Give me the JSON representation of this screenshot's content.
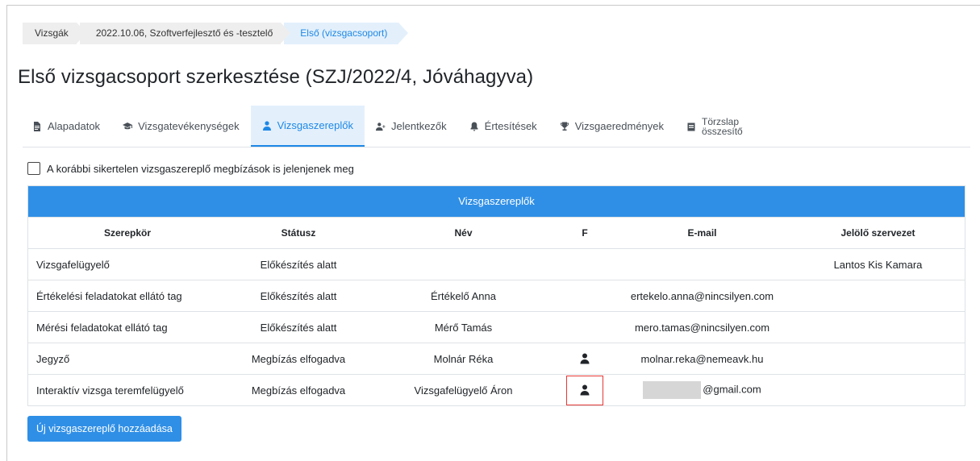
{
  "breadcrumb": [
    {
      "label": "Vizsgák"
    },
    {
      "label": "2022.10.06, Szoftverfejlesztő és -tesztelő"
    },
    {
      "label": "Első (vizsgacsoport)"
    }
  ],
  "page_title": "Első vizsgacsoport szerkesztése (SZJ/2022/4, Jóváhagyva)",
  "tabs": [
    {
      "label": "Alapadatok",
      "icon": "document-icon"
    },
    {
      "label": "Vizsgatevékenységek",
      "icon": "graduation-cap-icon"
    },
    {
      "label": "Vizsgaszereplők",
      "icon": "user-icon"
    },
    {
      "label": "Jelentkezők",
      "icon": "user-plus-icon"
    },
    {
      "label": "Értesítések",
      "icon": "bell-icon"
    },
    {
      "label": "Vizsgaeredmények",
      "icon": "trophy-icon"
    },
    {
      "label_line1": "Törzslap",
      "label_line2": "összesítő",
      "icon": "clipboard-icon"
    }
  ],
  "checkbox": {
    "label": "A korábbi sikertelen vizsgaszereplő megbízások is jelenjenek meg",
    "checked": false
  },
  "table": {
    "title": "Vizsgaszereplők",
    "columns": [
      "Szerepkör",
      "Státusz",
      "Név",
      "F",
      "E-mail",
      "Jelölő szervezet"
    ],
    "rows": [
      {
        "role": "Vizsgafelügyelő",
        "status": "Előkészítés alatt",
        "name": "",
        "f": false,
        "email": "",
        "org": "Lantos Kis Kamara"
      },
      {
        "role": "Értékelési feladatokat ellátó tag",
        "status": "Előkészítés alatt",
        "name": "Értékelő Anna",
        "f": false,
        "email": "ertekelo.anna@nincsilyen.com",
        "org": ""
      },
      {
        "role": "Mérési feladatokat ellátó tag",
        "status": "Előkészítés alatt",
        "name": "Mérő Tamás",
        "f": false,
        "email": "mero.tamas@nincsilyen.com",
        "org": ""
      },
      {
        "role": "Jegyző",
        "status": "Megbízás elfogadva",
        "name": "Molnár Réka",
        "f": true,
        "email": "molnar.reka@nemeavk.hu",
        "org": ""
      },
      {
        "role": "Interaktív vizsga teremfelügyelő",
        "status": "Megbízás elfogadva",
        "name": "Vizsgafelügyelő Áron",
        "f": true,
        "email": "@gmail.com",
        "org": ""
      }
    ]
  },
  "add_button": {
    "label": "Új vizsgaszereplő hozzáadása"
  },
  "colors": {
    "accent": "#2f8fe6",
    "active_tab_bg": "#e3f0fc",
    "highlight": "#e53935"
  }
}
